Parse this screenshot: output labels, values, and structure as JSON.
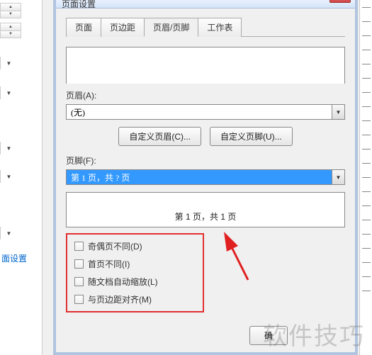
{
  "dialog": {
    "title": "页面设置",
    "tabs": [
      "页面",
      "页边距",
      "页眉/页脚",
      "工作表"
    ],
    "active_tab": 2,
    "header_label": "页眉(A):",
    "header_value": "(无)",
    "custom_header_btn": "自定义页眉(C)...",
    "custom_footer_btn": "自定义页脚(U)...",
    "footer_label": "页脚(F):",
    "footer_value": "第 1 页，共 ? 页",
    "footer_preview": "第 1 页，共 1 页",
    "options": [
      "奇偶页不同(D)",
      "首页不同(I)",
      "随文档自动缩放(L)",
      "与页边距对齐(M)"
    ],
    "ok_btn": "确"
  },
  "left": {
    "link_text": "面设置"
  },
  "watermark": "软件技巧"
}
